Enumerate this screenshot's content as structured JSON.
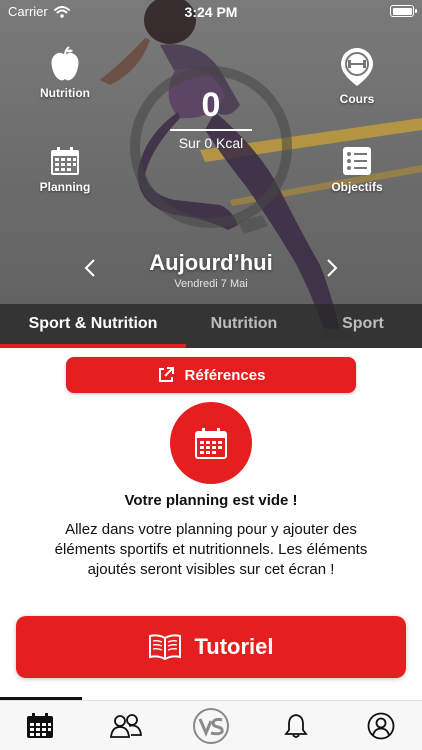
{
  "status_bar": {
    "carrier": "Carrier",
    "time": "3:24 PM"
  },
  "hero": {
    "shortcuts": {
      "nutrition": {
        "label": "Nutrition",
        "icon": "apple-icon"
      },
      "courses": {
        "label": "Cours",
        "icon": "dumbbell-pin-icon"
      },
      "planning": {
        "label": "Planning",
        "icon": "calendar-icon"
      },
      "objectives": {
        "label": "Objectifs",
        "icon": "checklist-icon"
      }
    },
    "kcal": {
      "value": "0",
      "label": "Sur 0 Kcal"
    },
    "day": {
      "title": "Aujourd’hui",
      "subtitle": "Vendredi 7 Mai"
    }
  },
  "tabs": [
    {
      "label": "Sport & Nutrition",
      "active": true
    },
    {
      "label": "Nutrition",
      "active": false
    },
    {
      "label": "Sport",
      "active": false
    }
  ],
  "references_button": {
    "label": "Références",
    "icon": "external-link-icon"
  },
  "empty_state": {
    "icon": "calendar-icon",
    "title": "Votre planning est vide !",
    "description": "Allez dans votre planning pour y ajouter des éléments sportifs et nutritionnels. Les éléments ajoutés seront visibles sur cet écran !"
  },
  "tutorial_button": {
    "label": "Tutoriel",
    "icon": "book-icon"
  },
  "bottom_nav": [
    {
      "name": "calendar",
      "icon": "calendar-icon",
      "active": true
    },
    {
      "name": "community",
      "icon": "users-icon",
      "active": false
    },
    {
      "name": "home",
      "icon": "vs-logo-icon",
      "active": false
    },
    {
      "name": "notifications",
      "icon": "bell-icon",
      "active": false
    },
    {
      "name": "profile",
      "icon": "user-icon",
      "active": false
    }
  ],
  "colors": {
    "accent": "#e51f1f",
    "tab_bar": "#2e2e2e",
    "hero_overlay": "#6d6d6d"
  }
}
